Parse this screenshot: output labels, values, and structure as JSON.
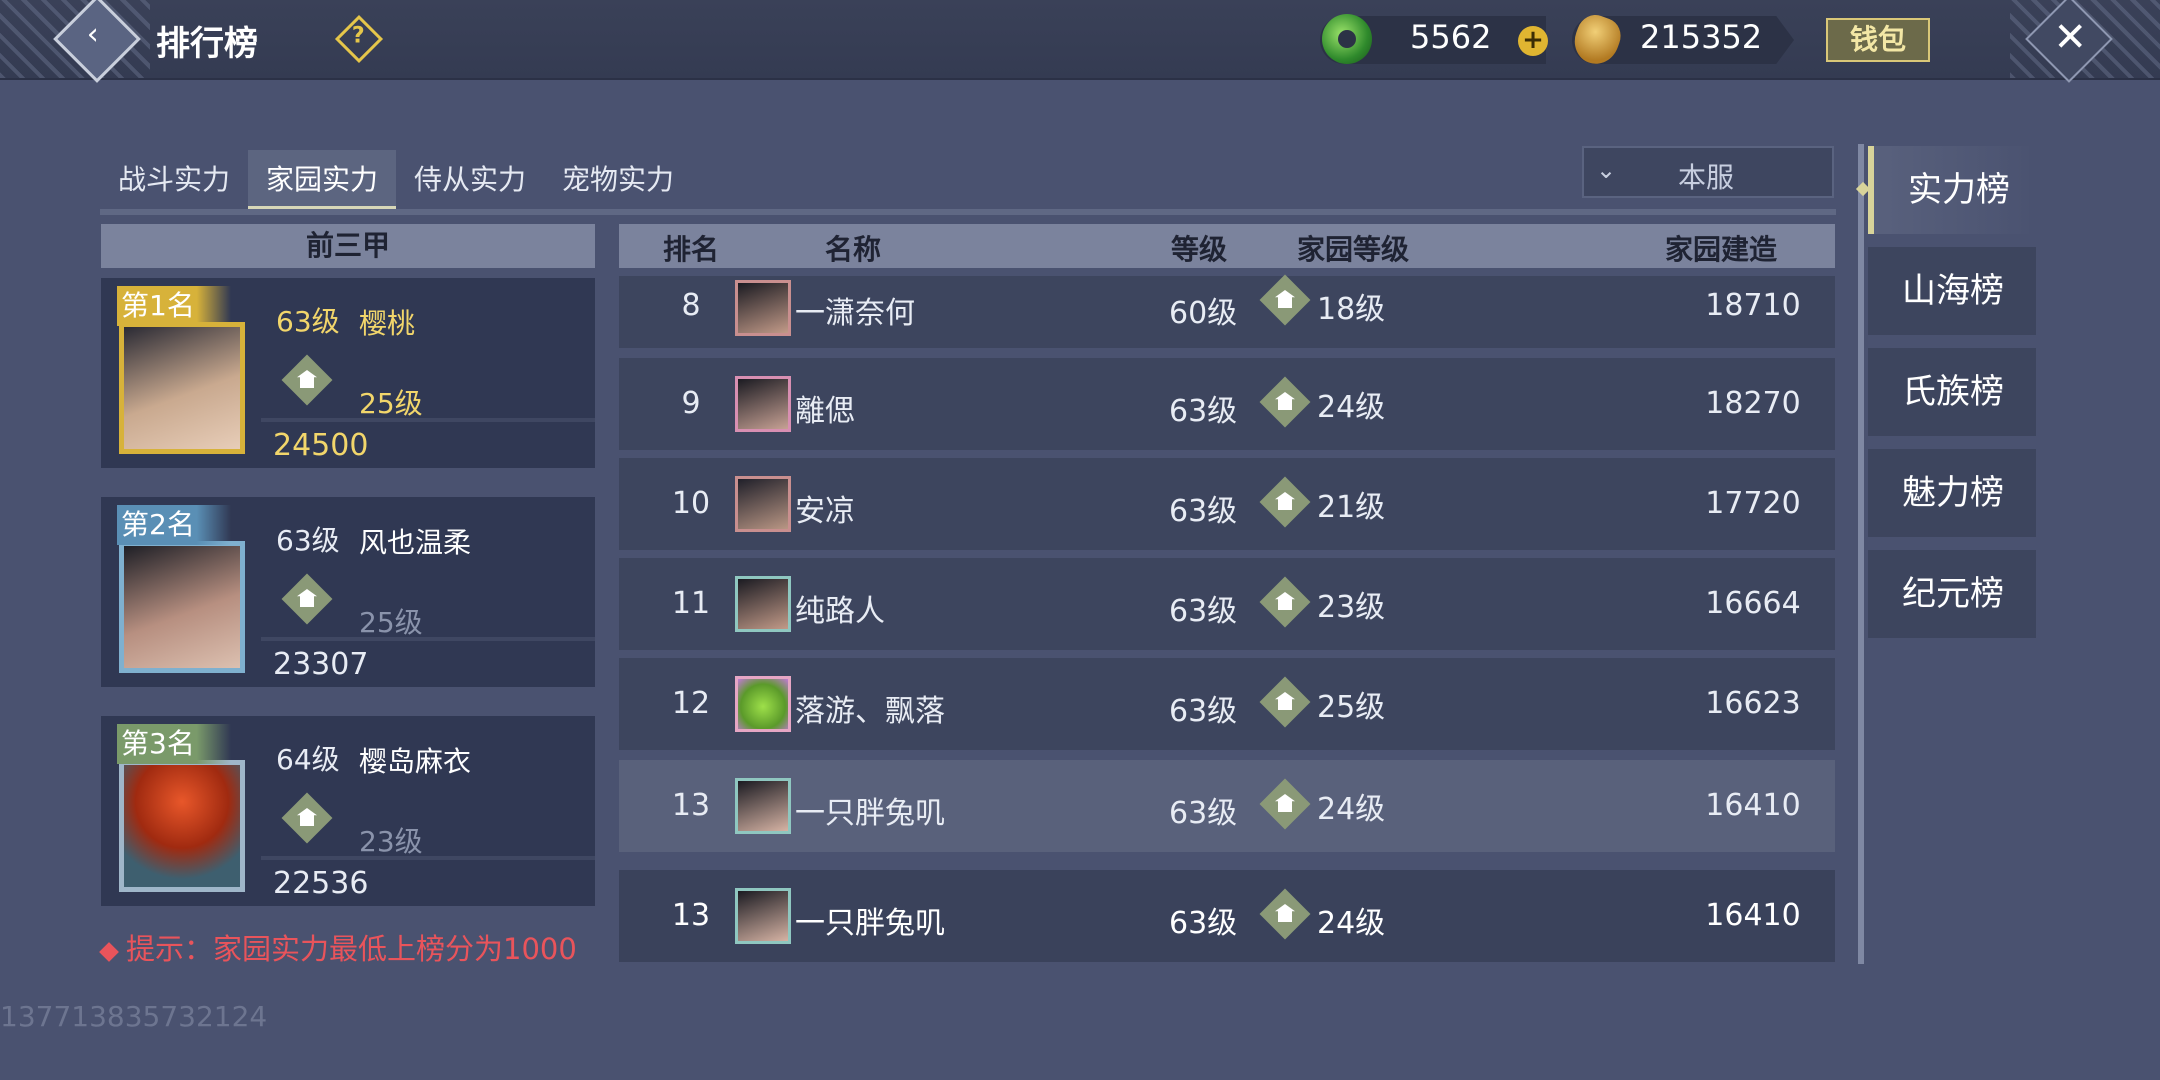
{
  "header": {
    "title": "排行榜",
    "help": "?",
    "jade_amount": "5562",
    "plus": "+",
    "coin_amount": "215352",
    "wallet": "钱包",
    "back": "‹",
    "close": "✕"
  },
  "tabs": [
    "战斗实力",
    "家园实力",
    "侍从实力",
    "宠物实力"
  ],
  "active_tab": 1,
  "server_filter": {
    "selected": "本服",
    "chevron": "⌄"
  },
  "rank_types": [
    "实力榜",
    "山海榜",
    "氏族榜",
    "魅力榜",
    "纪元榜"
  ],
  "active_rank_type": 0,
  "top3": {
    "header": "前三甲",
    "entries": [
      {
        "rank_label": "第1名",
        "level": "63级",
        "name": "樱桃",
        "home_level": "25级",
        "score": "24500"
      },
      {
        "rank_label": "第2名",
        "level": "63级",
        "name": "风也温柔",
        "home_level": "25级",
        "score": "23307"
      },
      {
        "rank_label": "第3名",
        "level": "64级",
        "name": "樱岛麻衣",
        "home_level": "23级",
        "score": "22536"
      }
    ]
  },
  "table": {
    "headers": {
      "rank": "排名",
      "name": "名称",
      "level": "等级",
      "home_level": "家园等级",
      "build": "家园建造"
    },
    "rows": [
      {
        "rank": "8",
        "name": "一潇奈何",
        "level": "60级",
        "home_level": "18级",
        "build": "18710"
      },
      {
        "rank": "9",
        "name": "離偲",
        "level": "63级",
        "home_level": "24级",
        "build": "18270"
      },
      {
        "rank": "10",
        "name": "安凉",
        "level": "63级",
        "home_level": "21级",
        "build": "17720"
      },
      {
        "rank": "11",
        "name": "纯路人",
        "level": "63级",
        "home_level": "23级",
        "build": "16664"
      },
      {
        "rank": "12",
        "name": "落游、飘落",
        "level": "63级",
        "home_level": "25级",
        "build": "16623"
      },
      {
        "rank": "13",
        "name": "一只胖兔叽",
        "level": "63级",
        "home_level": "24级",
        "build": "16410"
      }
    ],
    "self_row": {
      "rank": "13",
      "name": "一只胖兔叽",
      "level": "63级",
      "home_level": "24级",
      "build": "16410"
    }
  },
  "hint": "提示：家园实力最低上榜分为1000",
  "uid": "137713835732124",
  "colors": {
    "gold": "#f2d66b",
    "hint_red": "#e9545b",
    "faded": "#8a93ab"
  }
}
